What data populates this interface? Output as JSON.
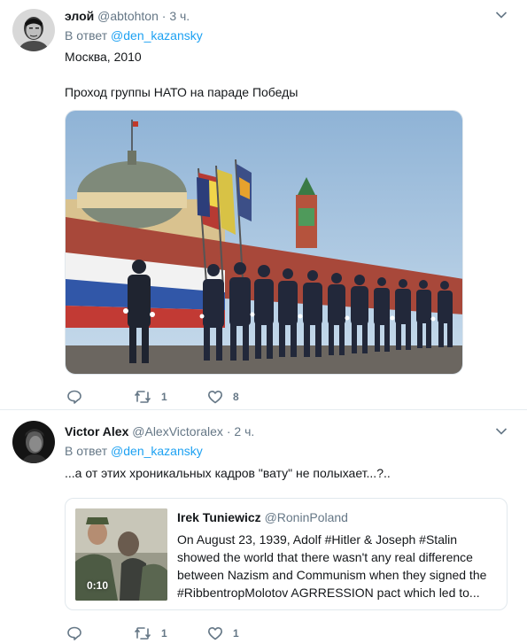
{
  "tweets": [
    {
      "name": "элой",
      "handle": "@abtohton",
      "dot": "·",
      "time": "3 ч.",
      "reply_prefix": "В ответ",
      "reply_mention": "@den_kazansky",
      "text_lines": [
        "Москва, 2010",
        "Проход группы НАТО на параде Победы"
      ],
      "actions": {
        "reply_count": "",
        "retweet_count": "1",
        "like_count": "8"
      }
    },
    {
      "name": "Victor Alex",
      "handle": "@AlexVictoralex",
      "dot": "·",
      "time": "2 ч.",
      "reply_prefix": "В ответ",
      "reply_mention": "@den_kazansky",
      "text_lines": [
        "...а от этих хроникальных кадров \"вату\" не полыхает...?.."
      ],
      "quote": {
        "name": "Irek Tuniewicz",
        "handle": "@RoninPoland",
        "video_time": "0:10",
        "lines": [
          "On August 23, 1939, Adolf #Hitler & Joseph #Stalin",
          "showed the world that there wasn't any real difference",
          "between Nazism and Communism when they signed the",
          "#RibbentropMolotov AGRRESSION pact which led to..."
        ]
      },
      "actions": {
        "reply_count": "",
        "retweet_count": "1",
        "like_count": "1"
      }
    }
  ],
  "colors": {
    "link": "#1da1f2",
    "secondary": "#657786",
    "border": "#e6ecf0"
  }
}
